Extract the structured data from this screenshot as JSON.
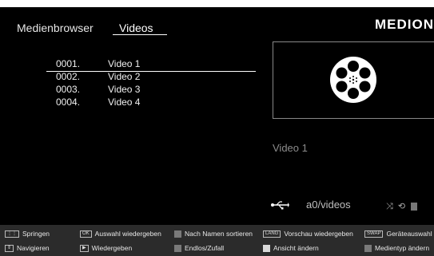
{
  "header": {
    "breadcrumbs": [
      "Medienbrowser",
      "Videos"
    ],
    "brand": "MEDION"
  },
  "file_list": [
    {
      "num": "0001.",
      "title": "Video 1",
      "selected": true
    },
    {
      "num": "0002.",
      "title": "Video 2",
      "selected": false
    },
    {
      "num": "0003.",
      "title": "Video 3",
      "selected": false
    },
    {
      "num": "0004.",
      "title": "Video 4",
      "selected": false
    }
  ],
  "preview": {
    "icon": "film-reel-icon",
    "title": "Video 1"
  },
  "source": {
    "icon": "usb-icon",
    "path": "a0/videos",
    "mode_icons": [
      "shuffle-icon",
      "repeat-icon",
      "view-icon"
    ]
  },
  "footer": {
    "row1": [
      {
        "key": "⋮⋮",
        "label": "Springen"
      },
      {
        "key": "OK",
        "label": "Auswahl wiedergeben"
      },
      {
        "key": "",
        "label": "Nach Namen sortieren",
        "color": "#7a7a7a"
      },
      {
        "key": "LANG",
        "label": "Vorschau wiedergeben"
      },
      {
        "key": "SWAP",
        "label": "Geräteauswahl"
      }
    ],
    "row2": [
      {
        "key": "⇕",
        "label": "Navigieren"
      },
      {
        "key": "▶",
        "label": "Wiedergeben"
      },
      {
        "key": "",
        "label": "Endlos/Zufall",
        "color": "#7a7a7a"
      },
      {
        "key": "",
        "label": "Ansicht ändern",
        "color": "#d9d9d9"
      },
      {
        "key": "",
        "label": "Medientyp ändern",
        "color": "#7a7a7a"
      }
    ]
  },
  "colors": {
    "background": "#000000",
    "footer_bg": "#2b2b2b",
    "text": "#ffffff"
  }
}
